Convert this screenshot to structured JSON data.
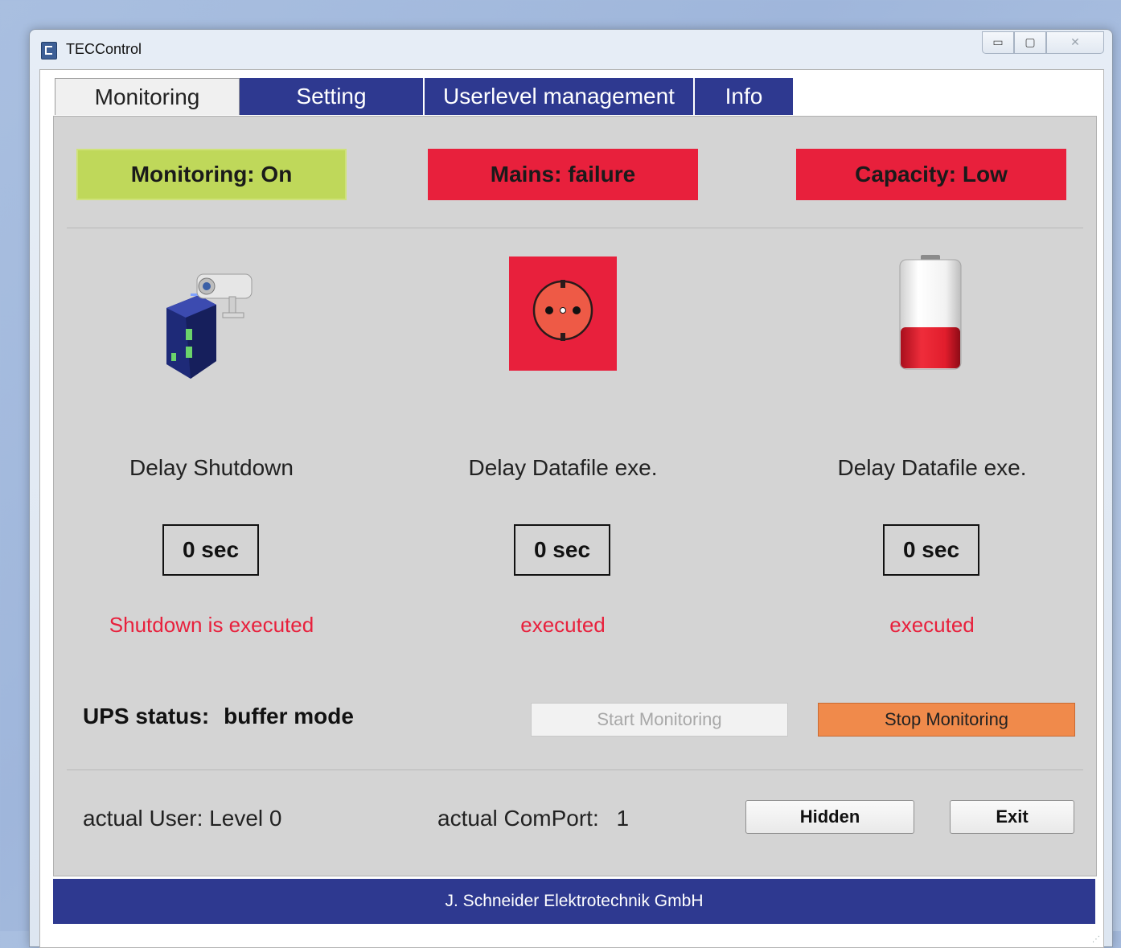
{
  "window": {
    "title": "TECControl",
    "controls": {
      "minimize": "▭",
      "restore": "▢",
      "close": "✕"
    }
  },
  "tabs": [
    {
      "label": "Monitoring",
      "active": true
    },
    {
      "label": "Setting",
      "active": false
    },
    {
      "label": "Userlevel management",
      "active": false
    },
    {
      "label": "Info",
      "active": false
    }
  ],
  "status": {
    "monitoring": "Monitoring:   On",
    "mains": "Mains:   failure",
    "capacity": "Capacity:   Low"
  },
  "columns": [
    {
      "icon": "ups-device-camera-icon",
      "label": "Delay Shutdown",
      "value": "0 sec",
      "result": "Shutdown is executed"
    },
    {
      "icon": "power-socket-icon",
      "label": "Delay Datafile exe.",
      "value": "0 sec",
      "result": "executed"
    },
    {
      "icon": "battery-low-icon",
      "label": "Delay Datafile exe.",
      "value": "0 sec",
      "result": "executed",
      "battery_level": 0.38
    }
  ],
  "ups": {
    "label": "UPS status:",
    "value": "buffer mode"
  },
  "buttons": {
    "start": "Start Monitoring",
    "stop": "Stop Monitoring",
    "hidden": "Hidden",
    "exit": "Exit"
  },
  "footer_info": {
    "user": "actual User: Level 0",
    "comport_label": "actual ComPort:",
    "comport_value": "1"
  },
  "footer": "J. Schneider Elektrotechnik GmbH",
  "colors": {
    "accent": "#2e3990",
    "status_ok": "#bfd85a",
    "status_alarm": "#e8203c",
    "stop_button": "#f08a4b"
  }
}
